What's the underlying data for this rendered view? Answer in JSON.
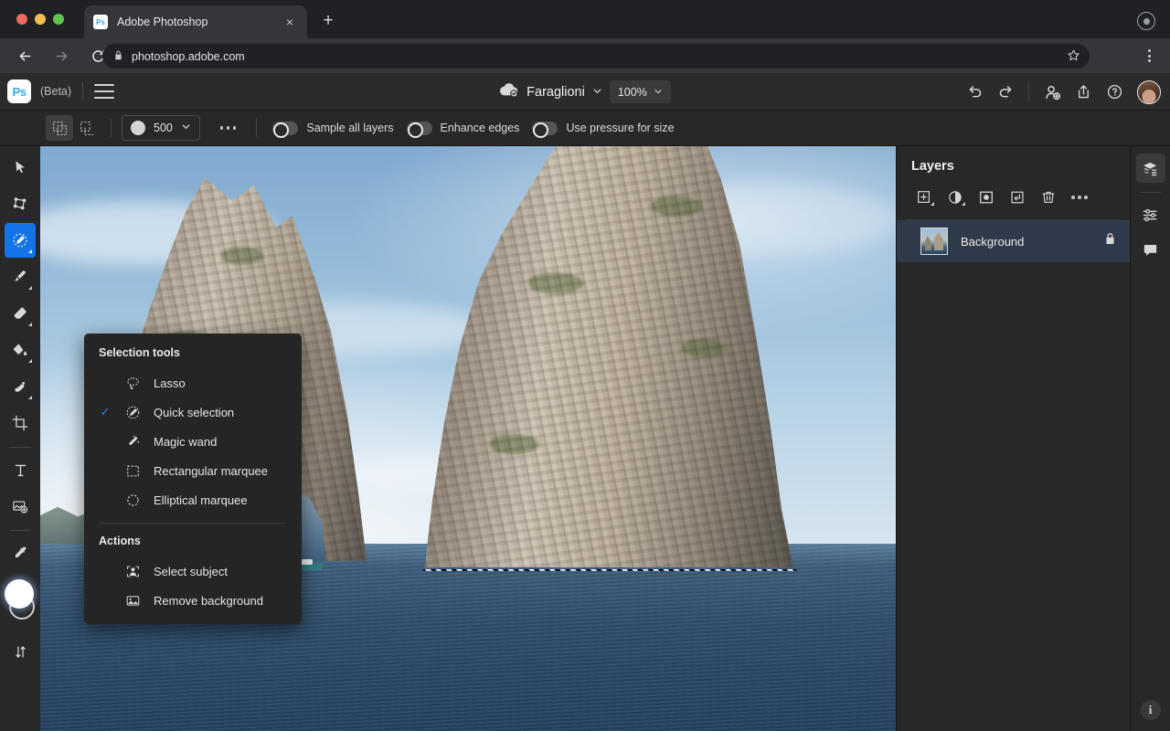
{
  "browser": {
    "tab": {
      "title": "Adobe Photoshop",
      "favicon": "photoshop-icon",
      "close": "×"
    },
    "new_tab": "+",
    "nav": {
      "back": "←",
      "forward": "→",
      "reload": "⟳"
    },
    "url": "photoshop.adobe.com",
    "lock_icon": "lock-icon",
    "star_icon": "bookmark-star-icon",
    "menu_icon": "browser-menu-icon",
    "extensions_icon": "extensions-icon"
  },
  "app": {
    "logo": "Ps",
    "beta_label": "(Beta)",
    "menu_icon": "hamburger-menu-icon",
    "document_name": "Faraglioni",
    "document_chevron": "⌄",
    "zoom_level": "100%",
    "zoom_chevron": "⌄",
    "cloud_icon": "cloud-saved-icon",
    "header_actions": [
      {
        "name": "undo-button",
        "icon": "undo-icon"
      },
      {
        "name": "redo-button",
        "icon": "redo-icon"
      },
      {
        "name": "invite-button",
        "icon": "add-person-icon"
      },
      {
        "name": "share-button",
        "icon": "share-icon"
      },
      {
        "name": "help-button",
        "icon": "help-circle-icon"
      }
    ],
    "avatar": "user-avatar"
  },
  "options_bar": {
    "new_selection_label": "New selection",
    "subtract_selection_label": "Subtract from selection",
    "brush_size": "500",
    "brush_chevron": "⌄",
    "more_options": "…",
    "toggles": [
      {
        "label": "Sample all layers",
        "on": false
      },
      {
        "label": "Enhance edges",
        "on": false
      },
      {
        "label": "Use pressure for size",
        "on": false
      }
    ]
  },
  "toolbar": {
    "tools": [
      {
        "name": "move-tool",
        "icon": "cursor-arrow-icon",
        "active": false,
        "has_flyout": false
      },
      {
        "name": "transform-tool",
        "icon": "transform-icon",
        "active": false,
        "has_flyout": false
      },
      {
        "name": "quick-selection-tool",
        "icon": "quick-selection-icon",
        "active": true,
        "has_flyout": true
      },
      {
        "name": "brush-tool",
        "icon": "brush-icon",
        "active": false,
        "has_flyout": true
      },
      {
        "name": "eraser-tool",
        "icon": "eraser-icon",
        "active": false,
        "has_flyout": true
      },
      {
        "name": "paint-bucket-tool",
        "icon": "paint-bucket-icon",
        "active": false,
        "has_flyout": true
      },
      {
        "name": "clone-stamp-tool",
        "icon": "healing-brush-icon",
        "active": false,
        "has_flyout": true
      },
      {
        "name": "crop-tool",
        "icon": "crop-icon",
        "active": false,
        "has_flyout": false
      },
      {
        "name": "type-tool",
        "icon": "type-icon",
        "active": false,
        "has_flyout": false
      },
      {
        "name": "place-image-tool",
        "icon": "add-image-icon",
        "active": false,
        "has_flyout": false
      },
      {
        "name": "eyedropper-tool",
        "icon": "eyedropper-icon",
        "active": false,
        "has_flyout": false
      }
    ],
    "color_swatches": "foreground-background-swatches",
    "sort_tool": "arrange-icon"
  },
  "flyout_menu": {
    "section_title": "Selection tools",
    "items": [
      {
        "label": "Lasso",
        "icon": "lasso-icon",
        "checked": false
      },
      {
        "label": "Quick selection",
        "icon": "quick-selection-icon",
        "checked": true
      },
      {
        "label": "Magic wand",
        "icon": "magic-wand-icon",
        "checked": false
      },
      {
        "label": "Rectangular marquee",
        "icon": "rectangular-marquee-icon",
        "checked": false
      },
      {
        "label": "Elliptical marquee",
        "icon": "elliptical-marquee-icon",
        "checked": false
      }
    ],
    "actions_title": "Actions",
    "actions": [
      {
        "label": "Select subject",
        "icon": "select-subject-icon"
      },
      {
        "label": "Remove background",
        "icon": "remove-background-icon"
      }
    ],
    "check_glyph": "✓"
  },
  "layers_panel": {
    "title": "Layers",
    "tools": [
      {
        "name": "add-layer-button",
        "icon": "add-layer-icon"
      },
      {
        "name": "adjustment-layer-button",
        "icon": "adjustment-circle-icon"
      },
      {
        "name": "layer-mask-button",
        "icon": "mask-icon"
      },
      {
        "name": "clipping-mask-button",
        "icon": "clipping-mask-icon"
      },
      {
        "name": "delete-layer-button",
        "icon": "trash-icon"
      },
      {
        "name": "layer-more-button",
        "icon": "ellipsis-icon"
      }
    ],
    "layers": [
      {
        "name": "Background",
        "locked": true,
        "selected": true,
        "lock_icon": "lock-icon"
      }
    ]
  },
  "right_rail": {
    "items": [
      {
        "name": "layers-panel-tab",
        "icon": "layers-icon",
        "active": true
      },
      {
        "name": "properties-panel-tab",
        "icon": "sliders-icon",
        "active": false
      },
      {
        "name": "comments-panel-tab",
        "icon": "comment-bubble-icon",
        "active": false
      }
    ],
    "info_button": "i"
  },
  "canvas": {
    "name": "image-canvas",
    "description": "Faraglioni sea stacks of Capri with marching-ants selection on right rock",
    "selection_active": true
  },
  "colors": {
    "accent_blue": "#1473e6",
    "check_blue": "#2c8ae0",
    "panel_bg": "#282828",
    "menu_bg": "#252525",
    "layer_selected_bg": "#2f3a4a",
    "browser_chrome": "#35363a",
    "titlebar": "#202124"
  }
}
